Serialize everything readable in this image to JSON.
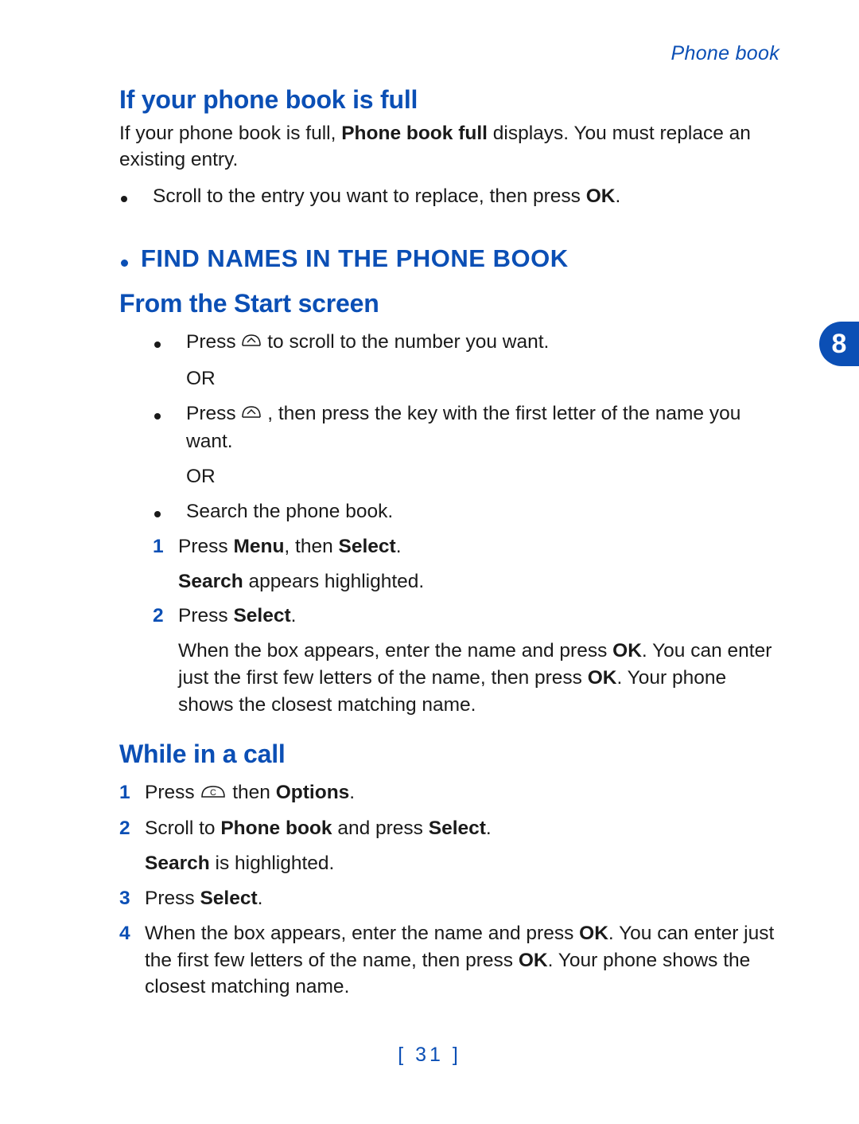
{
  "header": {
    "running_head": "Phone book"
  },
  "section_full": {
    "heading": "If your phone book is full",
    "para_pre": "If your phone book is full, ",
    "para_bold": "Phone book full",
    "para_post": " displays. You must replace an existing entry.",
    "bullet_pre": "Scroll to the entry you want to replace, then press ",
    "bullet_bold": "OK",
    "bullet_post": "."
  },
  "section_find": {
    "heading": "FIND NAMES IN THE PHONE BOOK",
    "sub1_heading": "From the Start screen",
    "b1_pre": "Press  ",
    "b1_post": " to scroll to the number you want.",
    "or": "OR",
    "b2_pre": "Press  ",
    "b2_post": ", then press the key with the first letter of the name you want.",
    "b3": "Search the phone book.",
    "step1_pre": "Press ",
    "step1_b1": "Menu",
    "step1_mid": ", then ",
    "step1_b2": "Select",
    "step1_post": ".",
    "step1_sub_b": "Search",
    "step1_sub_post": " appears highlighted.",
    "step2_pre": "Press ",
    "step2_b": "Select",
    "step2_post": ".",
    "step2_sub_pre": "When the box appears, enter the name and press ",
    "step2_sub_b1": "OK",
    "step2_sub_mid": ". You can enter just the first few letters of the name, then press ",
    "step2_sub_b2": "OK",
    "step2_sub_post": ". Your phone shows the closest matching name.",
    "sub2_heading": "While in a call",
    "c_step1_pre": "Press ",
    "c_step1_mid": " then ",
    "c_step1_b": "Options",
    "c_step1_post": ".",
    "c_step2_pre": "Scroll to ",
    "c_step2_b1": "Phone book",
    "c_step2_mid": " and press ",
    "c_step2_b2": "Select",
    "c_step2_post": ".",
    "c_step2_sub_b": "Search",
    "c_step2_sub_post": " is highlighted.",
    "c_step3_pre": "Press ",
    "c_step3_b": "Select",
    "c_step3_post": ".",
    "c_step4_pre": "When the box appears, enter the name and press ",
    "c_step4_b1": "OK",
    "c_step4_mid": ". You can enter just the first few letters of the name, then press ",
    "c_step4_b2": "OK",
    "c_step4_post": ". Your phone shows the closest matching name."
  },
  "nums": {
    "n1": "1",
    "n2": "2",
    "n3": "3",
    "n4": "4"
  },
  "footer": {
    "page_number": "[ 31 ]"
  },
  "tab": {
    "chapter": "8"
  }
}
